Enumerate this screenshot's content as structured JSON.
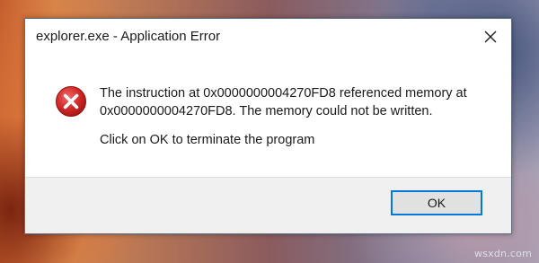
{
  "dialog": {
    "title": "explorer.exe - Application Error",
    "close_icon": "close-icon",
    "icon": "error-icon",
    "message_line1": "The instruction at 0x0000000004270FD8 referenced memory at",
    "message_line2": "0x0000000004270FD8. The memory could not be written.",
    "instruction": "Click on OK to terminate the program",
    "ok_label": "OK",
    "accent_color": "#0078d7",
    "error_color": "#d42a2a"
  },
  "watermark": "wsxdn.com"
}
